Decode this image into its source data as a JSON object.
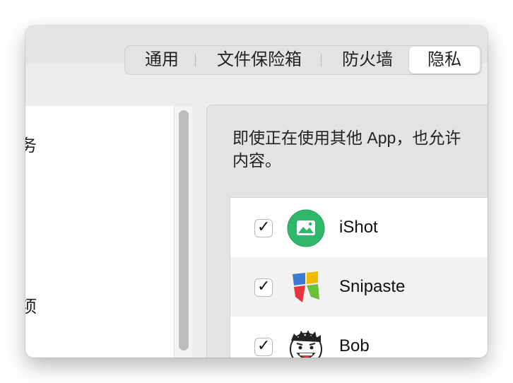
{
  "tabs": [
    {
      "label": "通用",
      "active": false
    },
    {
      "label": "文件保险箱",
      "active": false
    },
    {
      "label": "防火墙",
      "active": false
    },
    {
      "label": "隐私",
      "active": true
    }
  ],
  "sidebar": {
    "items": [
      {
        "label": "务"
      },
      {
        "label": "项"
      }
    ]
  },
  "privacy": {
    "description_line1": "即使正在使用其他 App，也允许",
    "description_line2": "内容。"
  },
  "apps": [
    {
      "name": "iShot",
      "checked": true,
      "icon": "ishot-icon",
      "checkmark": "✓"
    },
    {
      "name": "Snipaste",
      "checked": true,
      "icon": "snipaste-icon",
      "checkmark": "✓"
    },
    {
      "name": "Bob",
      "checked": true,
      "icon": "bob-icon",
      "checkmark": "✓"
    }
  ],
  "colors": {
    "ishot_green": "#2fb86a",
    "list_alt_row": "#f2f2f2",
    "snipaste_blue": "#3a7bd5",
    "snipaste_yellow": "#f5b800",
    "snipaste_red": "#e4363b",
    "snipaste_green": "#6cbf3a"
  }
}
